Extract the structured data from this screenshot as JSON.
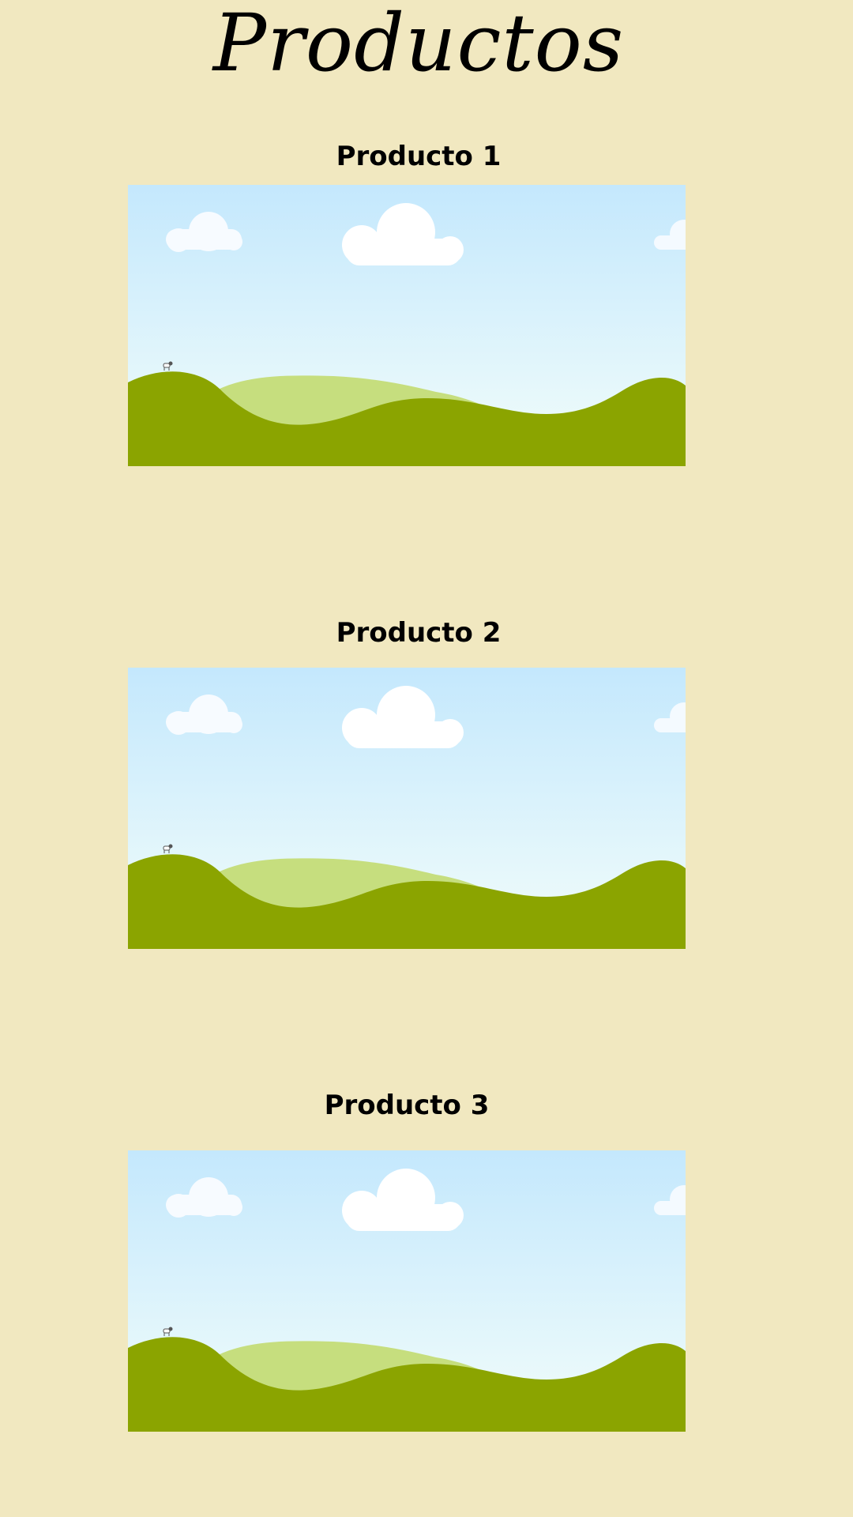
{
  "page": {
    "title": "Productos"
  },
  "products": [
    {
      "name": "Producto 1",
      "image_icon": "landscape-illustration"
    },
    {
      "name": "Producto 2",
      "image_icon": "landscape-illustration"
    },
    {
      "name": "Producto 3",
      "image_icon": "landscape-illustration"
    }
  ],
  "colors": {
    "background": "#f1e8c0",
    "sky_top": "#c4e8fd",
    "sky_bottom": "#eefcfb",
    "hill_light": "#c6de7e",
    "hill_dark": "#8ba400",
    "cloud": "#ffffff"
  }
}
